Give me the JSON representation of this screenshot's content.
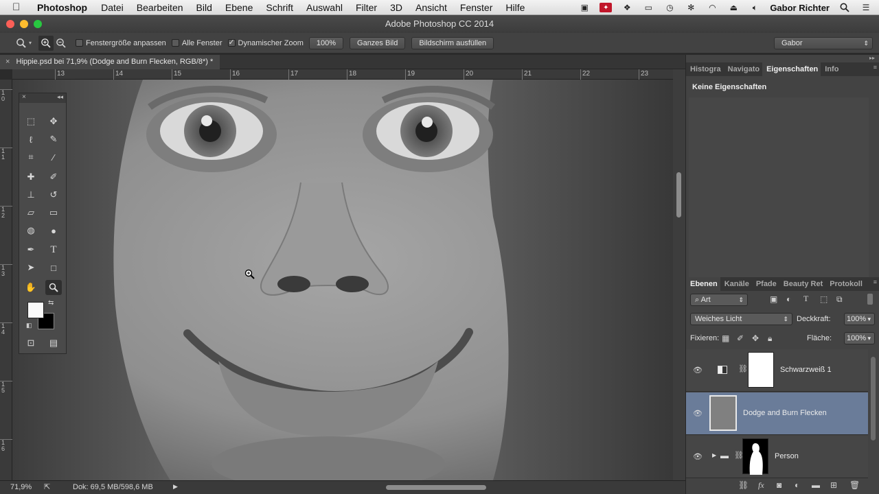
{
  "menubar": {
    "apple": "",
    "app_name": "Photoshop",
    "items": [
      "Datei",
      "Bearbeiten",
      "Bild",
      "Ebene",
      "Schrift",
      "Auswahl",
      "Filter",
      "3D",
      "Ansicht",
      "Fenster",
      "Hilfe"
    ],
    "user": "Gabor Richter"
  },
  "window": {
    "title": "Adobe Photoshop CC 2014"
  },
  "options": {
    "resize_windows": "Fenstergröße anpassen",
    "all_windows": "Alle Fenster",
    "scrubby_zoom": "Dynamischer Zoom",
    "btn_100": "100%",
    "btn_fit": "Ganzes Bild",
    "btn_fill": "Bildschirm ausfüllen",
    "workspace": "Gabor"
  },
  "document": {
    "tab_title": "Hippie.psd bei 71,9% (Dodge and Burn Flecken, RGB/8*) *",
    "close": "×"
  },
  "ruler": {
    "h": [
      "13",
      "14",
      "15",
      "16",
      "17",
      "18",
      "19",
      "20",
      "21",
      "22",
      "23"
    ],
    "v": [
      [
        "1",
        "0"
      ],
      [
        "1",
        "1"
      ],
      [
        "1",
        "2"
      ],
      [
        "1",
        "3"
      ],
      [
        "1",
        "4"
      ],
      [
        "1",
        "5"
      ],
      [
        "1",
        "6"
      ]
    ]
  },
  "status": {
    "zoom": "71,9%",
    "doc": "Dok: 69,5 MB/598,6 MB"
  },
  "panels": {
    "top_tabs": [
      "Histogra",
      "Navigato",
      "Eigenschaften",
      "Info"
    ],
    "properties_text": "Keine Eigenschaften",
    "layers_tabs": [
      "Ebenen",
      "Kanäle",
      "Pfade",
      "Beauty Ret",
      "Protokoll"
    ],
    "filter_kind": "Art",
    "blend_mode": "Weiches Licht",
    "opacity_label": "Deckkraft:",
    "opacity_value": "100%",
    "lock_label": "Fixieren:",
    "fill_label": "Fläche:",
    "fill_value": "100%",
    "layers": [
      {
        "name": "Schwarzweiß 1"
      },
      {
        "name": "Dodge and Burn Flecken"
      },
      {
        "name": "Person"
      }
    ]
  }
}
